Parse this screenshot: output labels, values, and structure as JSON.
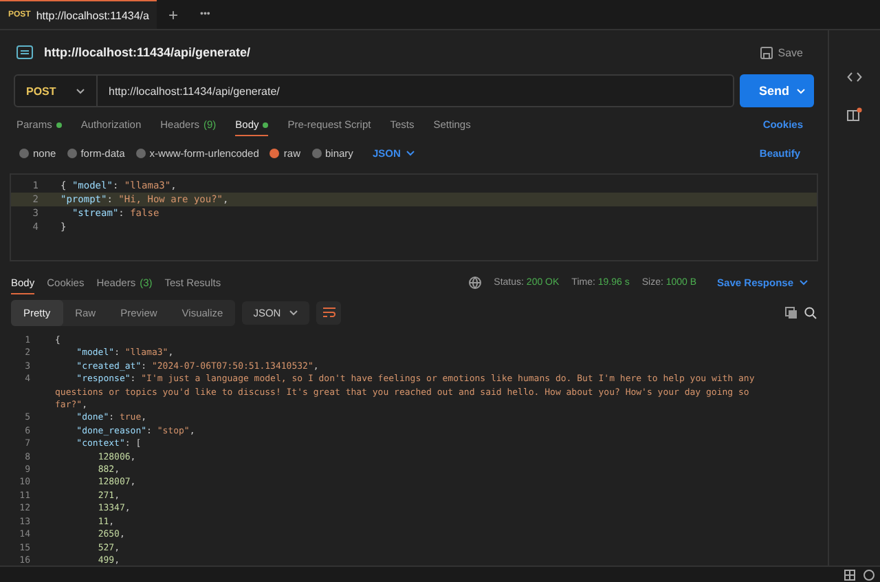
{
  "tab_bar": {
    "tabs": [
      {
        "method": "POST",
        "title": "http://localhost:11434/a",
        "selected": true
      }
    ],
    "add": "+",
    "more": "•••"
  },
  "request": {
    "title": "http://localhost:11434/api/generate/",
    "save": "Save",
    "method": "POST",
    "url": "http://localhost:11434/api/generate/",
    "send": "Send"
  },
  "request_tabs": [
    {
      "label": "Params",
      "dot": true,
      "selected": false
    },
    {
      "label": "Authorization",
      "selected": false
    },
    {
      "label": "Headers",
      "count": "(9)",
      "selected": false
    },
    {
      "label": "Body",
      "dot": true,
      "selected": true
    },
    {
      "label": "Pre-request Script",
      "selected": false
    },
    {
      "label": "Tests",
      "selected": false
    },
    {
      "label": "Settings",
      "selected": false
    }
  ],
  "cookies": "Cookies",
  "body_types": [
    {
      "label": "none",
      "selected": false
    },
    {
      "label": "form-data",
      "selected": false
    },
    {
      "label": "x-www-form-urlencoded",
      "selected": false
    },
    {
      "label": "raw",
      "selected": true
    },
    {
      "label": "binary",
      "selected": false
    }
  ],
  "body_format": "JSON",
  "beautify": "Beautify",
  "request_body": [
    {
      "number": "1",
      "highlighted": false,
      "tokens": [
        {
          "kind": "punct",
          "text": "{ "
        },
        {
          "kind": "key",
          "text": "\"model\""
        },
        {
          "kind": "punct",
          "text": ": "
        },
        {
          "kind": "string",
          "text": "\"llama3\""
        },
        {
          "kind": "punct",
          "text": ","
        }
      ]
    },
    {
      "number": "2",
      "highlighted": true,
      "tokens": [
        {
          "kind": "key",
          "text": "\"prompt\""
        },
        {
          "kind": "punct",
          "text": ": "
        },
        {
          "kind": "string",
          "text": "\"Hi, How are you?\""
        },
        {
          "kind": "punct",
          "text": ","
        }
      ]
    },
    {
      "number": "3",
      "highlighted": false,
      "tokens": [
        {
          "kind": "key",
          "text": "  \"stream\""
        },
        {
          "kind": "punct",
          "text": ": "
        },
        {
          "kind": "bool",
          "text": "false"
        }
      ]
    },
    {
      "number": "4",
      "highlighted": false,
      "tokens": [
        {
          "kind": "punct",
          "text": "}"
        }
      ]
    }
  ],
  "response_tabs": [
    {
      "label": "Body",
      "selected": true
    },
    {
      "label": "Cookies",
      "selected": false
    },
    {
      "label": "Headers",
      "count": "(3)",
      "selected": false
    },
    {
      "label": "Test Results",
      "selected": false
    }
  ],
  "status": {
    "status_label": "Status:",
    "status": "200 OK",
    "time_label": "Time:",
    "time": "19.96 s",
    "size_label": "Size:",
    "size": "1000 B",
    "save_response": "Save Response"
  },
  "view_modes": [
    {
      "label": "Pretty",
      "selected": true
    },
    {
      "label": "Raw",
      "selected": false
    },
    {
      "label": "Preview",
      "selected": false
    },
    {
      "label": "Visualize",
      "selected": false
    }
  ],
  "response_format": "JSON",
  "response_body": [
    {
      "number": "1",
      "tokens": [
        {
          "kind": "punct",
          "text": "{"
        }
      ]
    },
    {
      "number": "2",
      "tokens": [
        {
          "kind": "key",
          "text": "    \"model\""
        },
        {
          "kind": "punct",
          "text": ": "
        },
        {
          "kind": "string",
          "text": "\"llama3\""
        },
        {
          "kind": "punct",
          "text": ","
        }
      ]
    },
    {
      "number": "3",
      "tokens": [
        {
          "kind": "key",
          "text": "    \"created_at\""
        },
        {
          "kind": "punct",
          "text": ": "
        },
        {
          "kind": "string",
          "text": "\"2024-07-06T07:50:51.13410532\""
        },
        {
          "kind": "punct",
          "text": ","
        }
      ]
    },
    {
      "number": "4",
      "tokens": [
        {
          "kind": "key",
          "text": "    \"response\""
        },
        {
          "kind": "punct",
          "text": ": "
        },
        {
          "kind": "string",
          "text": "\"I'm just a language model, so I don't have feelings or emotions like humans do. But I'm here to help you with any questions or topics you'd like to discuss! It's great that you reached out and said hello. How about you? How's your day going so far?\""
        },
        {
          "kind": "punct",
          "text": ","
        }
      ]
    },
    {
      "number": "5",
      "tokens": [
        {
          "kind": "key",
          "text": "    \"done\""
        },
        {
          "kind": "punct",
          "text": ": "
        },
        {
          "kind": "bool",
          "text": "true"
        },
        {
          "kind": "punct",
          "text": ","
        }
      ]
    },
    {
      "number": "6",
      "tokens": [
        {
          "kind": "key",
          "text": "    \"done_reason\""
        },
        {
          "kind": "punct",
          "text": ": "
        },
        {
          "kind": "string",
          "text": "\"stop\""
        },
        {
          "kind": "punct",
          "text": ","
        }
      ]
    },
    {
      "number": "7",
      "tokens": [
        {
          "kind": "key",
          "text": "    \"context\""
        },
        {
          "kind": "punct",
          "text": ": ["
        }
      ]
    },
    {
      "number": "8",
      "tokens": [
        {
          "kind": "number",
          "text": "        128006"
        },
        {
          "kind": "punct",
          "text": ","
        }
      ]
    },
    {
      "number": "9",
      "tokens": [
        {
          "kind": "number",
          "text": "        882"
        },
        {
          "kind": "punct",
          "text": ","
        }
      ]
    },
    {
      "number": "10",
      "tokens": [
        {
          "kind": "number",
          "text": "        128007"
        },
        {
          "kind": "punct",
          "text": ","
        }
      ]
    },
    {
      "number": "11",
      "tokens": [
        {
          "kind": "number",
          "text": "        271"
        },
        {
          "kind": "punct",
          "text": ","
        }
      ]
    },
    {
      "number": "12",
      "tokens": [
        {
          "kind": "number",
          "text": "        13347"
        },
        {
          "kind": "punct",
          "text": ","
        }
      ]
    },
    {
      "number": "13",
      "tokens": [
        {
          "kind": "number",
          "text": "        11"
        },
        {
          "kind": "punct",
          "text": ","
        }
      ]
    },
    {
      "number": "14",
      "tokens": [
        {
          "kind": "number",
          "text": "        2650"
        },
        {
          "kind": "punct",
          "text": ","
        }
      ]
    },
    {
      "number": "15",
      "tokens": [
        {
          "kind": "number",
          "text": "        527"
        },
        {
          "kind": "punct",
          "text": ","
        }
      ]
    },
    {
      "number": "16",
      "tokens": [
        {
          "kind": "number",
          "text": "        499"
        },
        {
          "kind": "punct",
          "text": ","
        }
      ]
    }
  ]
}
